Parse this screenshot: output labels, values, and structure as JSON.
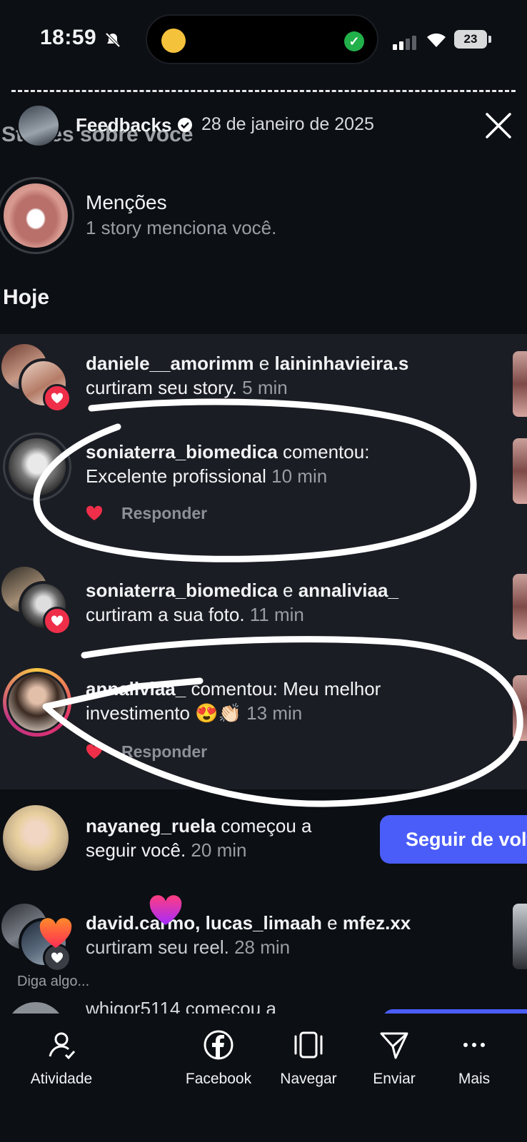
{
  "status_bar": {
    "time": "18:59",
    "battery": "23"
  },
  "story": {
    "username": "Feedbacks",
    "date": "28 de janeiro de 2025",
    "background_title": "Stories sobre você"
  },
  "mentions": {
    "title": "Menções",
    "subtitle": "1 story menciona você."
  },
  "section_today": "Hoje",
  "notifications": [
    {
      "users": [
        "daniele__amorimm",
        "laininhavieira.s"
      ],
      "connector": "e",
      "action": "curtiram seu story.",
      "time": "5 min"
    },
    {
      "user": "soniaterra_biomedica",
      "action": "comentou:",
      "comment": "Excelente profissional",
      "time": "10 min",
      "reply_label": "Responder"
    },
    {
      "users": [
        "soniaterra_biomedica",
        "annaliviaa_"
      ],
      "connector": "e",
      "action": "curtiram a sua foto.",
      "time": "11 min"
    },
    {
      "user": "annaliviaa_",
      "action": "comentou: Meu melhor",
      "comment": "investimento 😍👏🏻",
      "time": "13 min",
      "reply_label": "Responder"
    },
    {
      "user": "nayaneg_ruela",
      "action": "começou a",
      "action2": "seguir você.",
      "time": "20 min",
      "button": "Seguir de volta"
    },
    {
      "users_text": "david.carmo, lucas_limaah",
      "connector": "e",
      "last_user": "mfez.xx",
      "action": "curtiram seu reel.",
      "time": "28 min"
    },
    {
      "partial": "whigor5114 começou a"
    }
  ],
  "reply_placeholder": "Diga algo...",
  "bottom_nav": [
    {
      "label": "Atividade",
      "icon": "activity-icon"
    },
    {
      "label": "Facebook",
      "icon": "facebook-icon"
    },
    {
      "label": "Navegar",
      "icon": "browse-icon"
    },
    {
      "label": "Enviar",
      "icon": "send-icon"
    },
    {
      "label": "Mais",
      "icon": "more-icon"
    }
  ],
  "colors": {
    "background": "#0c0f14",
    "panel": "#1b1d24",
    "like": "#ef2f4a",
    "follow_button": "#4a5df9",
    "muted_text": "#9a9da3"
  }
}
